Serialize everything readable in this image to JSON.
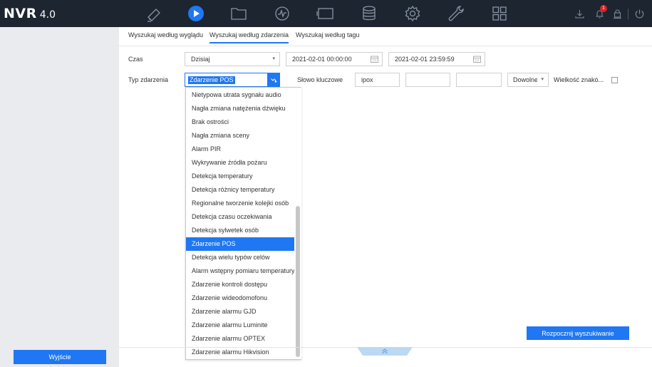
{
  "app": {
    "brand": "NVR",
    "version": "4.0"
  },
  "topnav": [
    {
      "name": "live-view-camera-icon",
      "active": false
    },
    {
      "name": "playback-icon",
      "active": true
    },
    {
      "name": "folder-icon",
      "active": false
    },
    {
      "name": "smart-analysis-icon",
      "active": false
    },
    {
      "name": "display-screen-icon",
      "active": false
    },
    {
      "name": "storage-database-icon",
      "active": false
    },
    {
      "name": "settings-gear-icon",
      "active": false
    },
    {
      "name": "maintenance-wrench-icon",
      "active": false
    },
    {
      "name": "grid-apps-icon",
      "active": false
    }
  ],
  "notifications": {
    "count": "1"
  },
  "colors": {
    "topbar": "#1c2530",
    "accent": "#1f77f3",
    "active_nav": "#1f77f3",
    "sidebar": "#e9ebef"
  },
  "tabs": [
    {
      "label": "Wyszukaj według wyglądu",
      "active": false
    },
    {
      "label": "Wyszukaj według zdarzenia",
      "active": true
    },
    {
      "label": "Wyszukaj według tagu",
      "active": false
    }
  ],
  "form": {
    "time_label": "Czas",
    "time_value": "Dzisiaj",
    "start_datetime": "2021-02-01 00:00:00",
    "end_datetime": "2021-02-01 23:59:59",
    "event_type_label": "Typ zdarzenia",
    "event_type_value": "Zdarzenie POS",
    "keyword_label": "Słowo kluczowe",
    "keyword_1": "ipox",
    "keyword_2": "",
    "keyword_3": "",
    "match_value": "Dowolne",
    "case_label": "Wielkość znakó..."
  },
  "dropdown": {
    "selected_index": 11,
    "items": [
      "Nietypowa utrata sygnału audio",
      "Nagła zmiana natężenia dźwięku",
      "Brak ostrości",
      "Nagła zmiana sceny",
      "Alarm PIR",
      "Wykrywanie źródła pożaru",
      "Detekcja temperatury",
      "Detekcja różnicy temperatury",
      "Regionalne tworzenie kolejki osób",
      "Detekcja czasu oczekiwania",
      "Detekcja sylwetek osób",
      "Zdarzenie POS",
      "Detekcja wielu typów celów",
      "Alarm wstępny pomiaru temperatury",
      "Zdarzenie kontroli dostępu",
      "Zdarzenie wideodomofonu",
      "Zdarzenie alarmu GJD",
      "Zdarzenie alarmu Luminite",
      "Zdarzenie alarmu OPTEX",
      "Zdarzenie alarmu Hikvision"
    ]
  },
  "buttons": {
    "search": "Rozpocznij wyszukiwanie",
    "exit": "Wyjście"
  }
}
